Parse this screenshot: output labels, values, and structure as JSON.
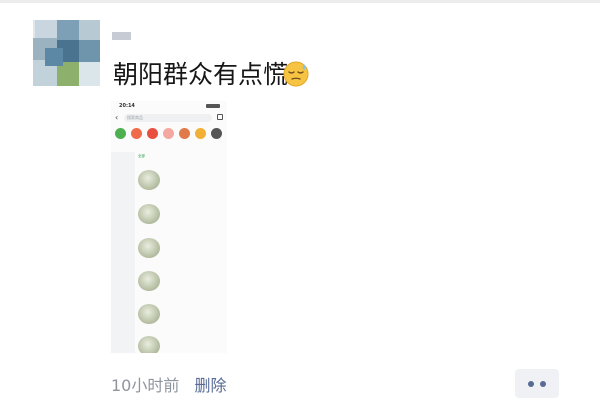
{
  "post": {
    "author_name": "",
    "text": "朝阳群众有点慌",
    "emoji": "sleepy-sweat-face-emoji",
    "time_ago": "10小时前",
    "delete_label": "删除",
    "more_icon": "two-dots-icon"
  },
  "screenshot": {
    "status_time": "20:14",
    "search_placeholder": "搜索商品",
    "categories": [
      "",
      "",
      "",
      "",
      "",
      "",
      ""
    ],
    "filters": [
      "全部",
      "",
      "",
      "",
      "",
      ""
    ],
    "sidebar": [
      "",
      "",
      "",
      "",
      "",
      "",
      "",
      "",
      "",
      "",
      "",
      ""
    ],
    "products": [
      {
        "title": "",
        "desc": "",
        "price": "",
        "b1": "",
        "b2": ""
      },
      {
        "title": "",
        "desc": "",
        "price": "",
        "b1": "",
        "b2": ""
      },
      {
        "title": "",
        "desc": "",
        "price": "",
        "b1": "",
        "b2": ""
      },
      {
        "title": "",
        "desc": "",
        "price": "",
        "b1": "",
        "b2": ""
      },
      {
        "title": "",
        "desc": "",
        "price": "",
        "b1": "",
        "b2": ""
      },
      {
        "title": "",
        "desc": "",
        "price": "",
        "b1": "",
        "b2": ""
      }
    ]
  },
  "colors": {
    "link": "#576b95",
    "meta": "#8f959e",
    "price": "#e8452c"
  }
}
